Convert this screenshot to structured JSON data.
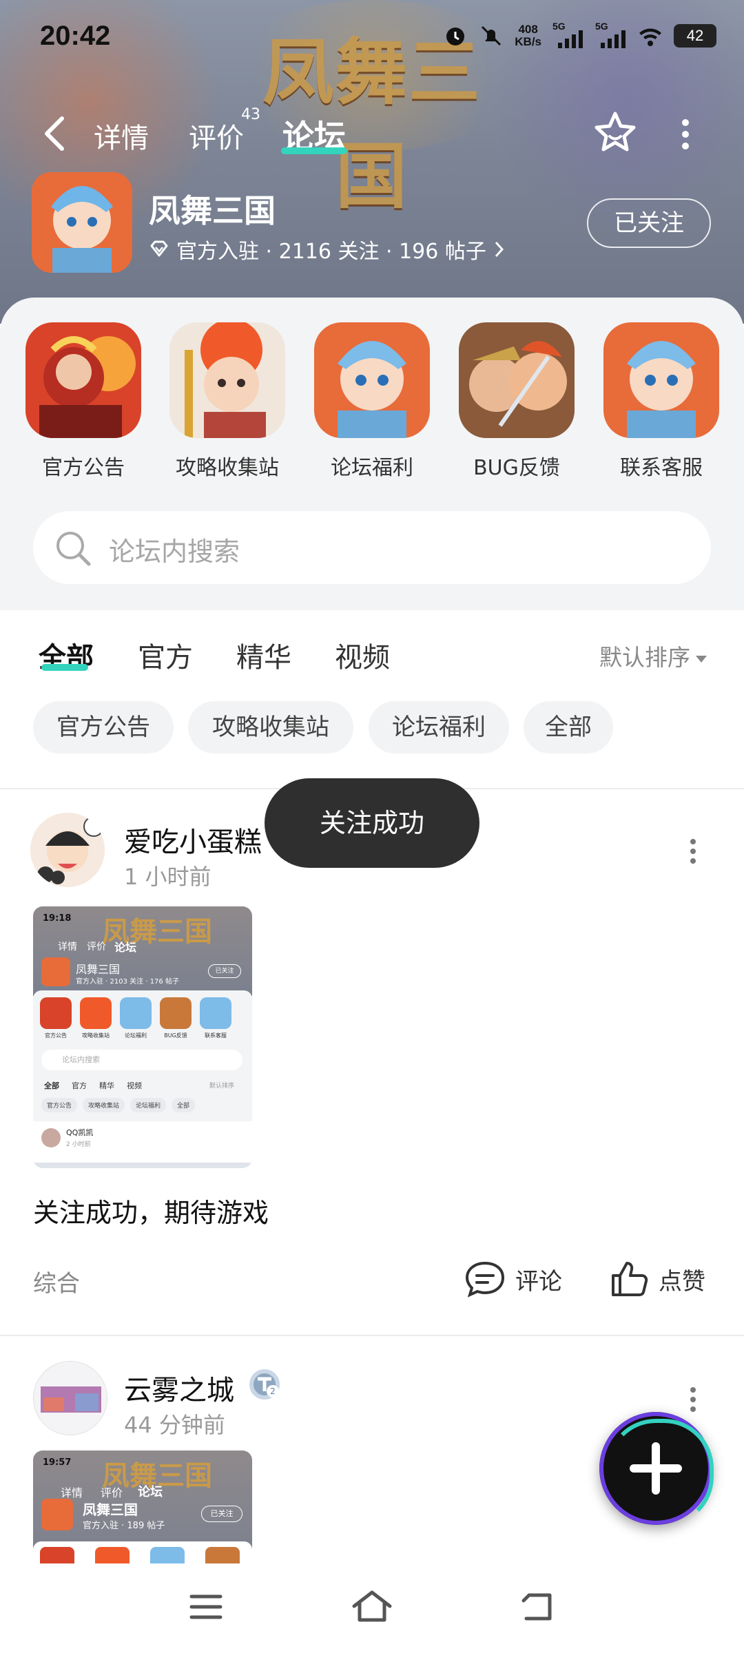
{
  "status_bar": {
    "time": "20:42",
    "speed_value": "408",
    "speed_unit": "KB/s",
    "signal1": "5G",
    "signal2": "5G",
    "battery": "42"
  },
  "header": {
    "game_logo": "凤舞三国",
    "tabs": [
      {
        "label": "详情"
      },
      {
        "label": "评价",
        "count": "43"
      },
      {
        "label": "论坛"
      }
    ],
    "forum": {
      "name": "凤舞三国",
      "meta": "官方入驻 · 2116 关注 · 196 帖子",
      "follow_label": "已关注"
    }
  },
  "quick_links": [
    {
      "label": "官方公告"
    },
    {
      "label": "攻略收集站"
    },
    {
      "label": "论坛福利"
    },
    {
      "label": "BUG反馈"
    },
    {
      "label": "联系客服"
    }
  ],
  "search": {
    "placeholder": "论坛内搜索"
  },
  "filter_tabs": [
    {
      "label": "全部"
    },
    {
      "label": "官方"
    },
    {
      "label": "精华"
    },
    {
      "label": "视频"
    }
  ],
  "sort_label": "默认排序",
  "chips": [
    {
      "label": "官方公告"
    },
    {
      "label": "攻略收集站"
    },
    {
      "label": "论坛福利"
    },
    {
      "label": "全部"
    }
  ],
  "toast": "关注成功",
  "posts": [
    {
      "author": "爱吃小蛋糕",
      "time": "1 小时前",
      "text": "关注成功，期待游戏",
      "category": "综合",
      "comment_label": "评论",
      "like_label": "点赞",
      "thumb": {
        "time": "19:18",
        "tabs": [
          "详情",
          "评价",
          "论坛"
        ],
        "forum_name": "凤舞三国",
        "meta": "官方入驻 · 2103 关注 · 176 帖子",
        "follow": "已关注",
        "links": [
          "官方公告",
          "攻略收集站",
          "论坛福利",
          "BUG反馈",
          "联系客服"
        ],
        "search": "论坛内搜索",
        "filters": [
          "全部",
          "官方",
          "精华",
          "视频"
        ],
        "sort": "默认排序",
        "chips": [
          "官方公告",
          "攻略收集站",
          "论坛福利",
          "全部"
        ],
        "author": "QQ凯凯",
        "post_time": "2 小时前"
      }
    },
    {
      "author": "云雾之城",
      "time": "44 分钟前",
      "thumb": {
        "time": "19:57",
        "tabs": [
          "详情",
          "评价",
          "论坛"
        ],
        "forum_name": "凤舞三国",
        "meta": "官方入驻 · 189 帖子",
        "follow": "已关注"
      }
    }
  ],
  "colors": {
    "accent": "#34d3bd",
    "toast_bg": "#2f2f2f",
    "fab_ring": "#6b3ee0"
  }
}
